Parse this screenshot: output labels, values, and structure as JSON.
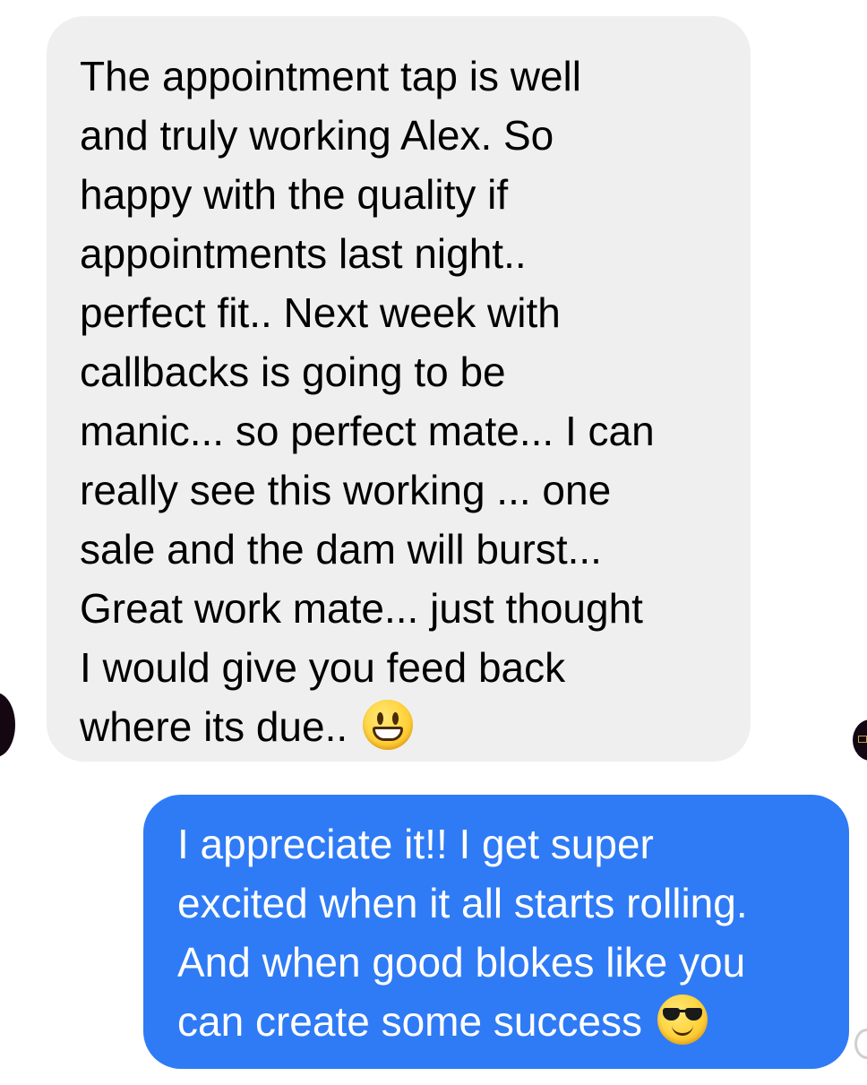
{
  "messages": {
    "incoming": {
      "text": "The appointment tap is well\nand truly working Alex. So\nhappy with the quality if\nappointments last night..\nperfect fit.. Next week with\ncallbacks is going to be\nmanic... so perfect mate... I can\nreally see this working ... one\nsale and the dam will burst...\nGreat work mate... just thought\nI would give you feed back\nwhere its due.. ",
      "emoji": "grinning-face"
    },
    "outgoing": {
      "text": "I appreciate it!! I get super\nexcited when it all starts rolling.\nAnd when good blokes like you\ncan create some success ",
      "emoji": "smiling-face-with-sunglasses"
    }
  },
  "colors": {
    "incoming_bubble": "#efefef",
    "outgoing_bubble": "#2f7bf6",
    "incoming_text": "#000000",
    "outgoing_text": "#ffffff"
  }
}
